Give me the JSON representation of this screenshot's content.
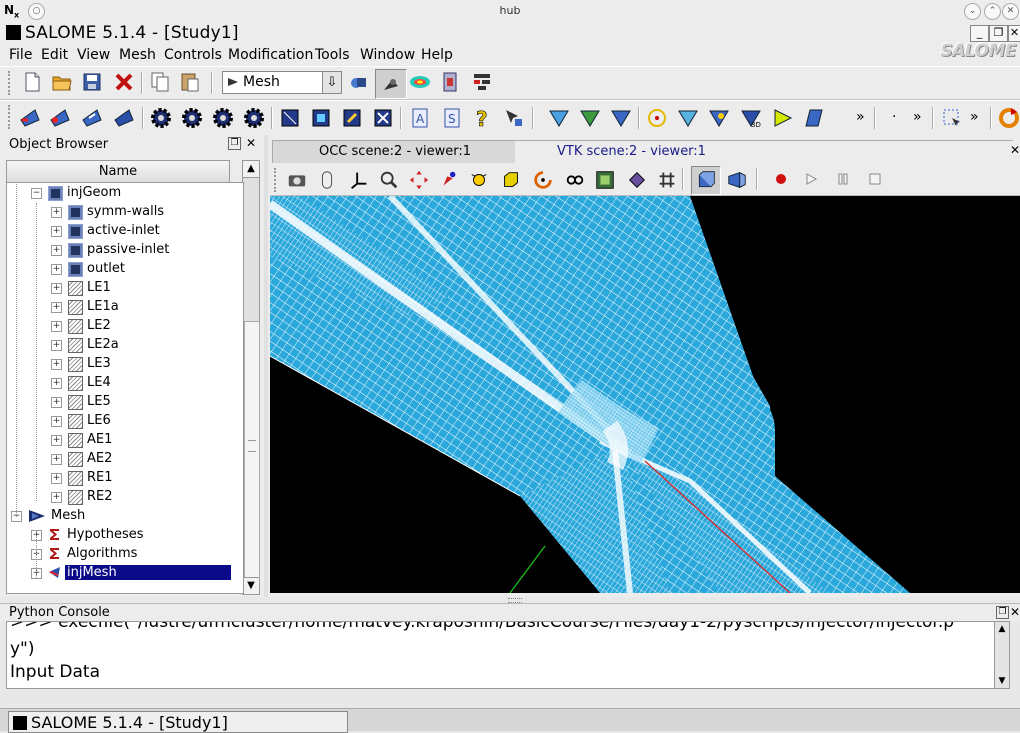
{
  "outer_window": {
    "title": "hub"
  },
  "app_window": {
    "title": "SALOME 5.1.4 - [Study1]"
  },
  "menubar": {
    "items": [
      "File",
      "Edit",
      "View",
      "Mesh",
      "Controls",
      "Modification",
      "Tools",
      "Window",
      "Help"
    ],
    "brand": "SALOME"
  },
  "toolbar": {
    "module_select": "Mesh",
    "more_glyph": "»"
  },
  "object_browser": {
    "title": "Object Browser",
    "column_header": "Name",
    "items": [
      {
        "label": "injGeom",
        "depth": 1,
        "icon": "geometry-object-icon"
      },
      {
        "label": "symm-walls",
        "depth": 2,
        "icon": "group-icon"
      },
      {
        "label": "active-inlet",
        "depth": 2,
        "icon": "group-icon"
      },
      {
        "label": "passive-inlet",
        "depth": 2,
        "icon": "group-icon"
      },
      {
        "label": "outlet",
        "depth": 2,
        "icon": "group-icon"
      },
      {
        "label": "LE1",
        "depth": 2,
        "icon": "face-icon"
      },
      {
        "label": "LE1a",
        "depth": 2,
        "icon": "face-icon"
      },
      {
        "label": "LE2",
        "depth": 2,
        "icon": "face-icon"
      },
      {
        "label": "LE2a",
        "depth": 2,
        "icon": "face-icon"
      },
      {
        "label": "LE3",
        "depth": 2,
        "icon": "face-icon"
      },
      {
        "label": "LE4",
        "depth": 2,
        "icon": "face-icon"
      },
      {
        "label": "LE5",
        "depth": 2,
        "icon": "face-icon"
      },
      {
        "label": "LE6",
        "depth": 2,
        "icon": "face-icon"
      },
      {
        "label": "AE1",
        "depth": 2,
        "icon": "face-icon"
      },
      {
        "label": "AE2",
        "depth": 2,
        "icon": "face-icon"
      },
      {
        "label": "RE1",
        "depth": 2,
        "icon": "face-icon"
      },
      {
        "label": "RE2",
        "depth": 2,
        "icon": "face-icon"
      },
      {
        "label": "Mesh",
        "depth": 0,
        "icon": "mesh-module-icon"
      },
      {
        "label": "Hypotheses",
        "depth": 1,
        "icon": "hypothesis-icon"
      },
      {
        "label": "Algorithms",
        "depth": 1,
        "icon": "algorithm-icon"
      },
      {
        "label": "injMesh",
        "depth": 1,
        "icon": "mesh-object-icon",
        "selected": true
      }
    ]
  },
  "viewer": {
    "tabs": [
      {
        "label": "OCC scene:2 - viewer:1",
        "active": false
      },
      {
        "label": "VTK scene:2 - viewer:1",
        "active": true
      }
    ],
    "background_color": "#000000",
    "mesh_color": "#2aa8dc"
  },
  "python_console": {
    "title": "Python Console",
    "lines": [
      ">>> execfile(\"/lustre/ufmcluster/home/matvey.kraposhin/BasicCourse/Files/day1-2/pyscripts/injector/injector.p",
      "y\")",
      "Input Data"
    ]
  },
  "taskbar": {
    "active_window": "SALOME 5.1.4 - [Study1]"
  },
  "colors": {
    "selection": "#0b0b8a",
    "window_bg": "#ececec"
  }
}
